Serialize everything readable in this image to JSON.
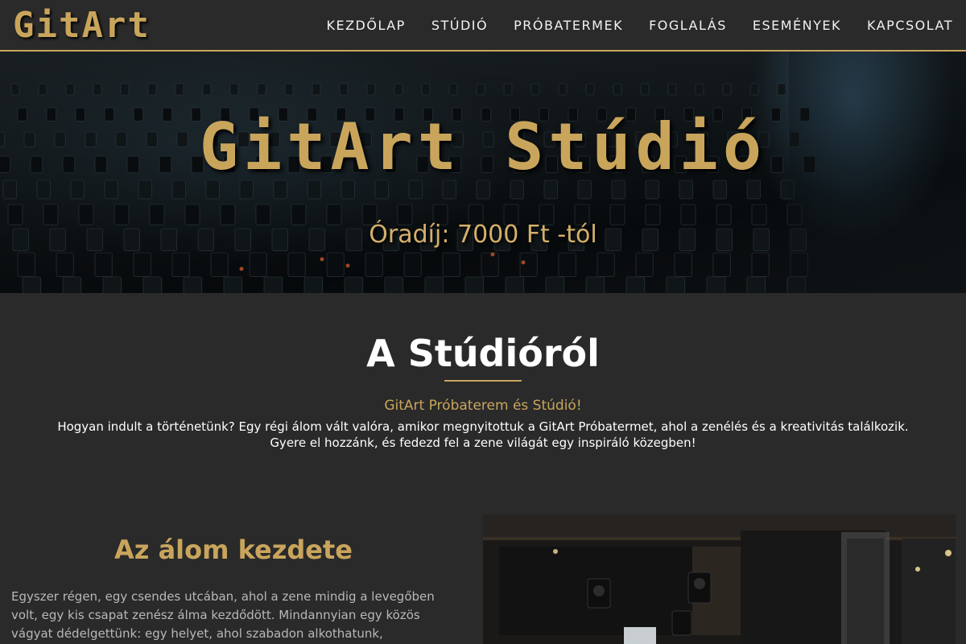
{
  "brand": {
    "logo": "GitArt"
  },
  "nav": {
    "items": [
      {
        "label": "KEZDŐLAP"
      },
      {
        "label": "STÚDIÓ"
      },
      {
        "label": "PRÓBATERMEK"
      },
      {
        "label": "FOGLALÁS"
      },
      {
        "label": "ESEMÉNYEK"
      },
      {
        "label": "KAPCSOLAT"
      }
    ]
  },
  "hero": {
    "title": "GitArt Stúdió",
    "subtitle": "Óradíj: 7000 Ft -tól"
  },
  "about": {
    "title": "A Stúdióról",
    "subtitle": "GitArt Próbaterem és Stúdió!",
    "text_line1": "Hogyan indult a történetünk? Egy régi álom vált valóra, amikor megnyitottuk a GitArt Próbatermet, ahol a zenélés és a kreativitás találkozik.",
    "text_line2": "Gyere el hozzánk, és fedezd fel a zene világát egy inspiráló közegben!"
  },
  "story": {
    "title": "Az álom kezdete",
    "text": "Egyszer régen, egy csendes utcában, ahol a zene mindig a levegőben volt, egy kis csapat zenész álma kezdődött. Mindannyian egy közös vágyat dédelgettünk: egy helyet, ahol szabadon alkothatunk, próbálhatunk és"
  },
  "colors": {
    "accent": "#c9a55c",
    "background": "#2a2a2a",
    "text": "#ffffff",
    "muted_text": "#b8b8b8"
  }
}
